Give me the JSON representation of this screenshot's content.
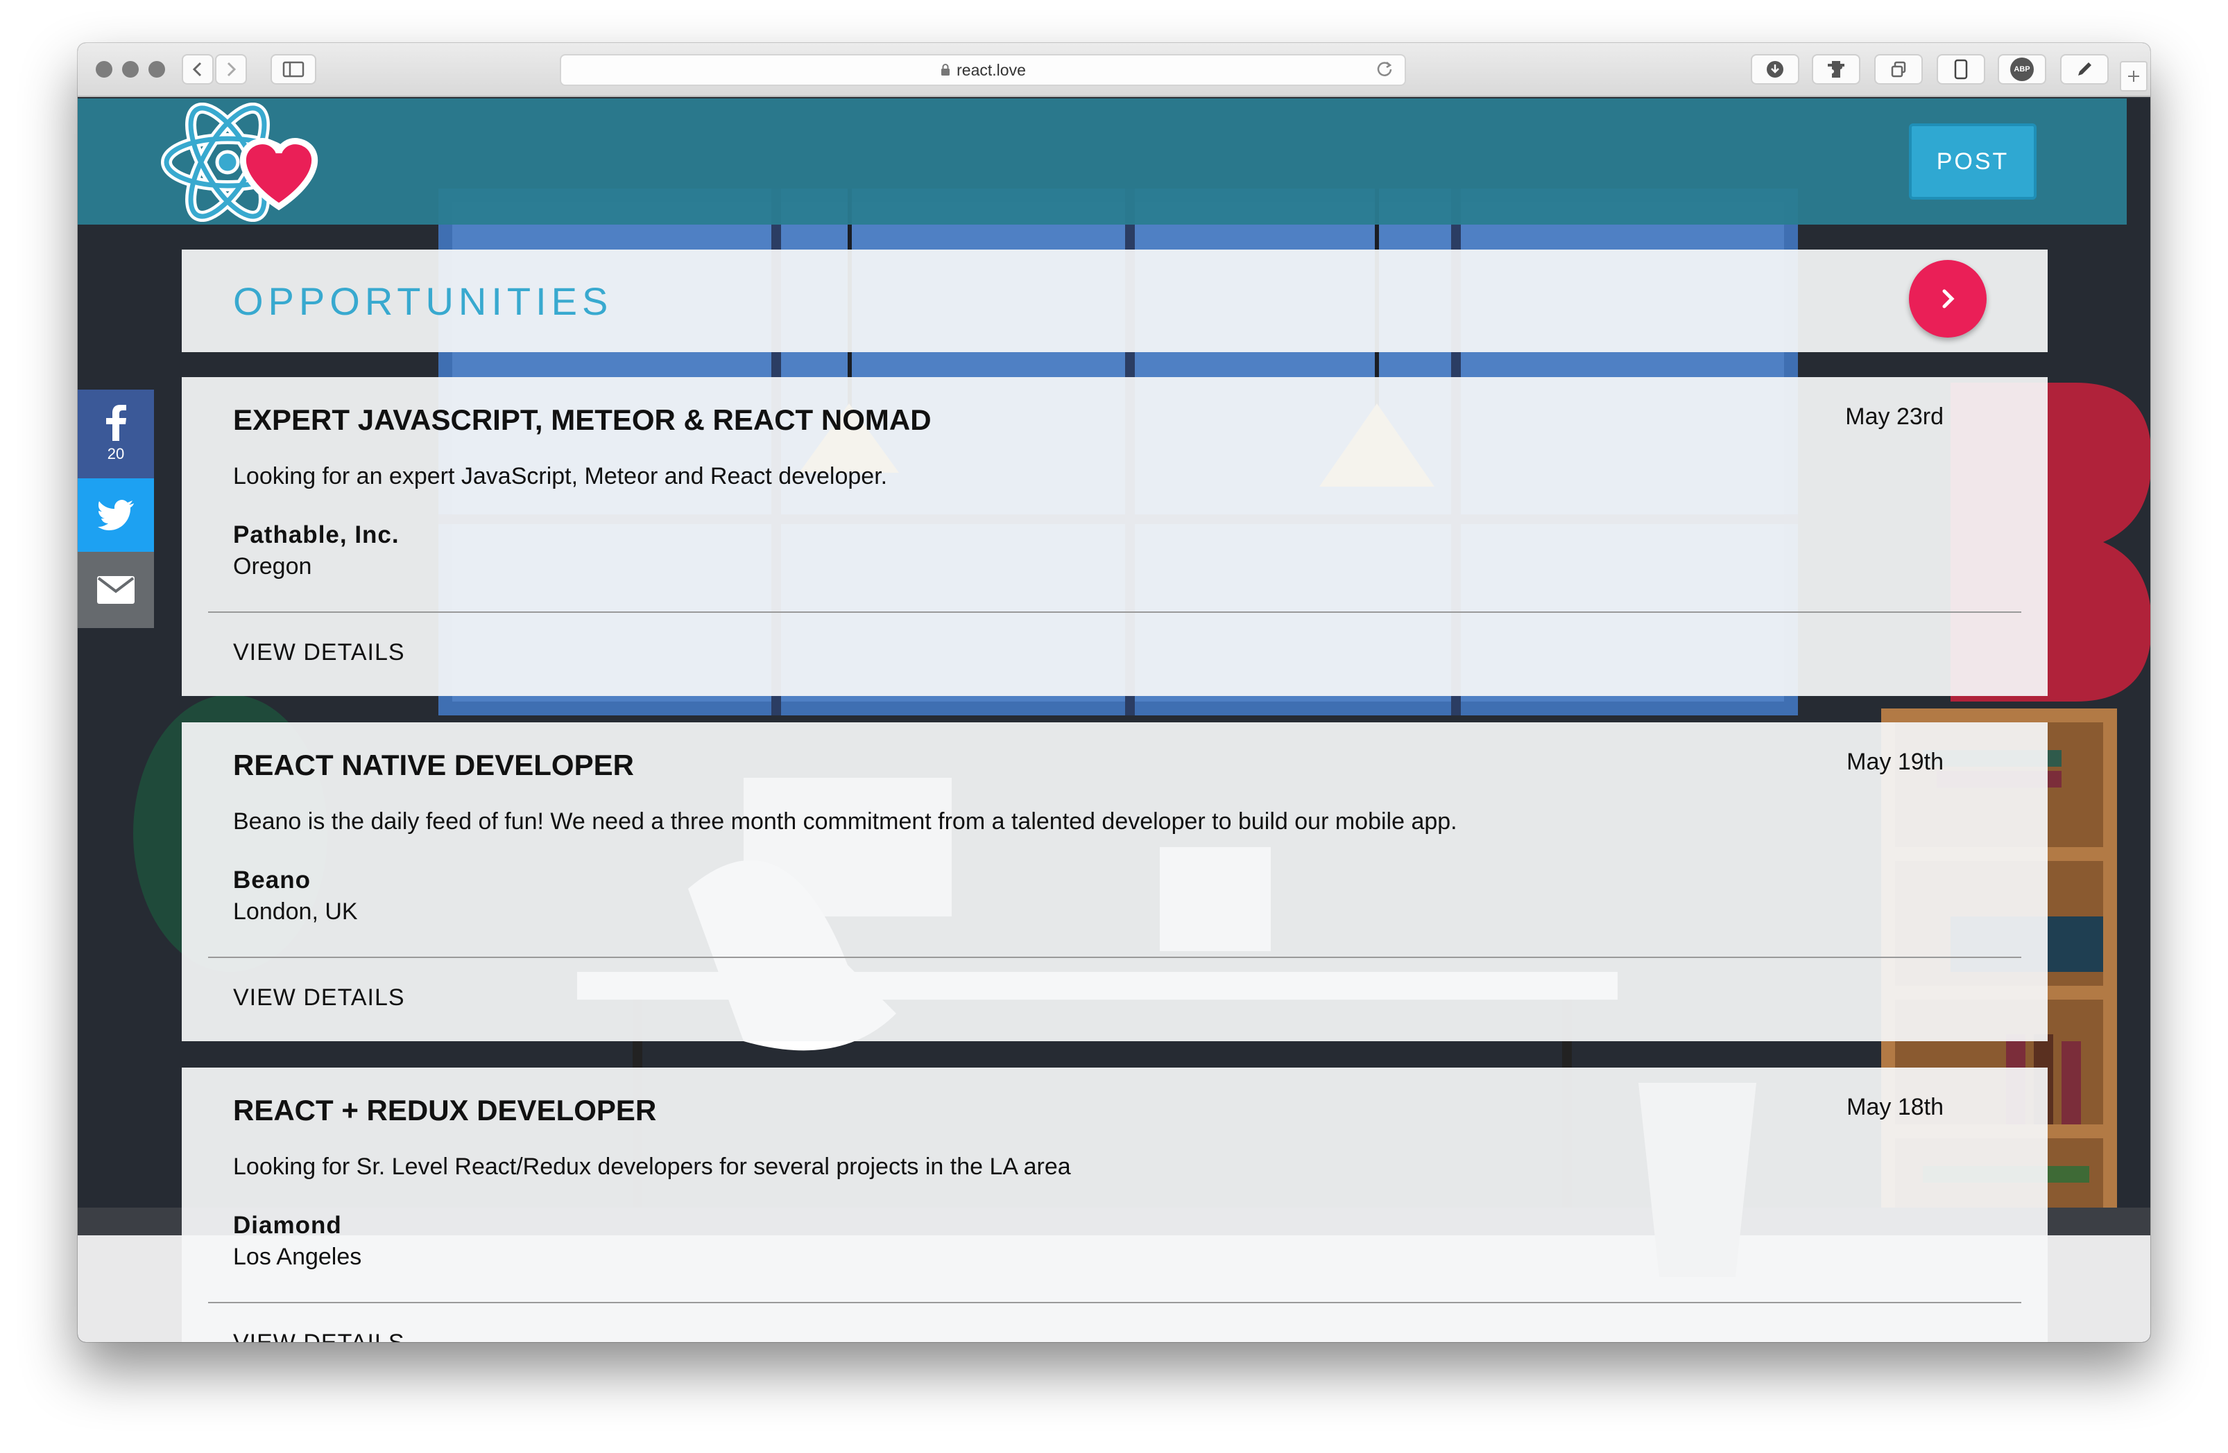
{
  "browser": {
    "url": "react.love",
    "lock_icon": "lock-icon",
    "toolbar_icons": [
      "download-icon",
      "puzzle-icon",
      "tabs-icon",
      "device-icon",
      "abp-icon",
      "edit-icon"
    ],
    "abp_label": "ABP"
  },
  "header": {
    "logo_icon": "react-love-logo",
    "post_label": "POST"
  },
  "opportunities": {
    "title": "OPPORTUNITIES",
    "next_icon": "chevron-right-icon"
  },
  "social": {
    "facebook_count": "20",
    "icons": [
      "facebook-icon",
      "twitter-icon",
      "email-icon"
    ]
  },
  "jobs": [
    {
      "title": "EXPERT JAVASCRIPT, METEOR & REACT NOMAD",
      "date": "May 23rd",
      "description": "Looking for an expert JavaScript, Meteor and React developer.",
      "company": "Pathable, Inc.",
      "location": "Oregon",
      "details_label": "VIEW DETAILS"
    },
    {
      "title": "REACT NATIVE DEVELOPER",
      "date": "May 19th",
      "description": "Beano is the daily feed of fun! We need a three month commitment from a talented developer to build our mobile app.",
      "company": "Beano",
      "location": "London, UK",
      "details_label": "VIEW DETAILS"
    },
    {
      "title": "REACT + REDUX DEVELOPER",
      "date": "May 18th",
      "description": "Looking for Sr. Level React/Redux developers for several projects in the LA area",
      "company": "Diamond",
      "location": "Los Angeles",
      "details_label": "VIEW DETAILS"
    }
  ],
  "colors": {
    "header": "#2a7c91",
    "accent": "#38a9cf",
    "post_button": "#2fa8d2",
    "next_button": "#ea1f57",
    "facebook": "#3b5998",
    "twitter": "#1da1f2",
    "email": "#666a6e"
  }
}
